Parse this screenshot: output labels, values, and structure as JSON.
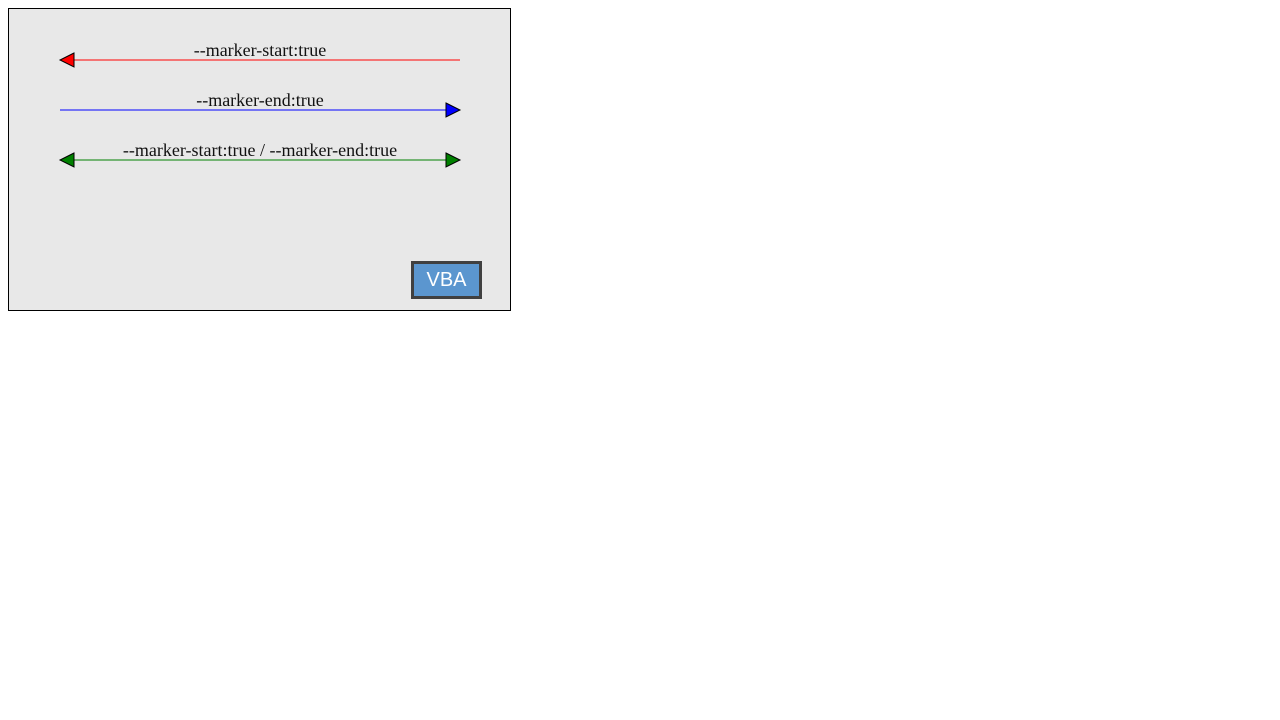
{
  "diagram": {
    "background": "#e8e8e8",
    "arrows": [
      {
        "label": "--marker-start:true",
        "color": "#ff0000",
        "marker_start": true,
        "marker_end": false
      },
      {
        "label": "--marker-end:true",
        "color": "#0000ff",
        "marker_start": false,
        "marker_end": true
      },
      {
        "label": "--marker-start:true / --marker-end:true",
        "color": "#008000",
        "marker_start": true,
        "marker_end": true
      }
    ]
  },
  "button": {
    "label": "VBA",
    "color": "#5b96cf"
  }
}
